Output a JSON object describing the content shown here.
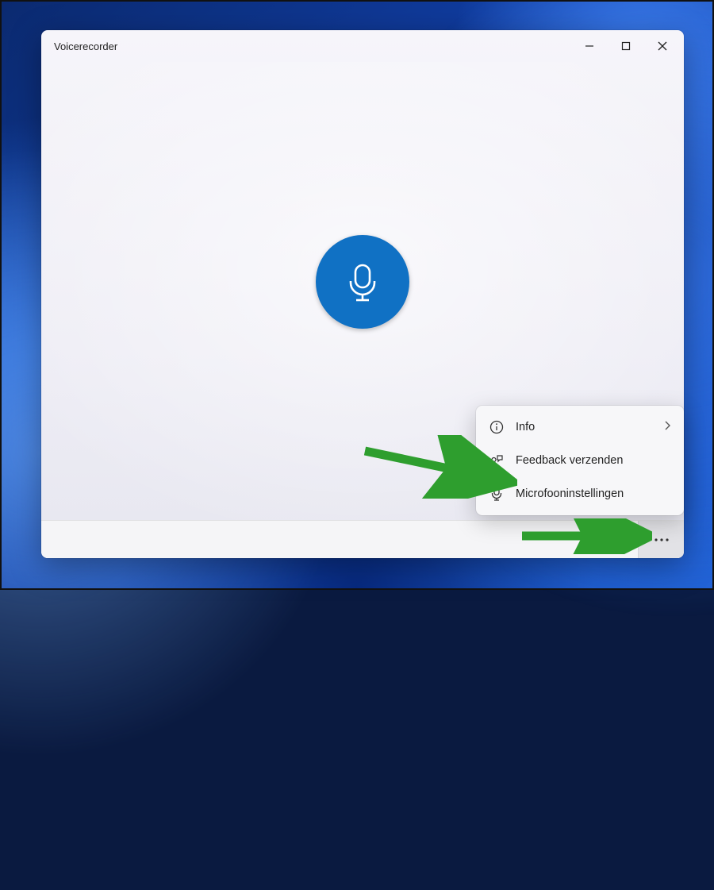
{
  "window": {
    "title": "Voicerecorder"
  },
  "flyout": {
    "items": [
      {
        "label": "Info",
        "icon": "info-icon",
        "has_chevron": true
      },
      {
        "label": "Feedback verzenden",
        "icon": "feedback-icon",
        "has_chevron": false
      },
      {
        "label": "Microfooninstellingen",
        "icon": "microphone-small-icon",
        "has_chevron": false
      }
    ]
  },
  "colors": {
    "record_button": "#1071c4",
    "arrow": "#2e9e2e"
  }
}
